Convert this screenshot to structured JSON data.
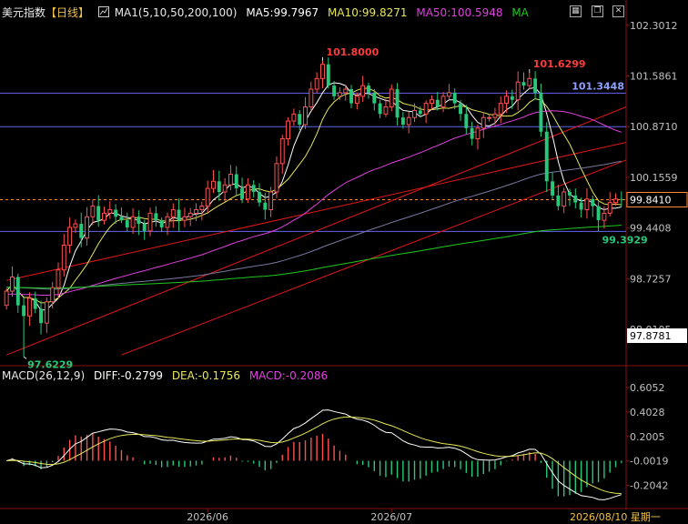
{
  "header": {
    "symbol": "美元指数",
    "period": "【日线】",
    "ma_group": "MA1(5,10,50,200,100)",
    "ma5": "MA5:99.7967",
    "ma10": "MA10:99.8271",
    "ma50": "MA50:100.5948",
    "ma_more": "MA",
    "icon": "indicator-icon",
    "window_buttons": [
      "grid-icon",
      "restore-icon",
      "close-icon"
    ]
  },
  "macd_header": {
    "name": "MACD(26,12,9)",
    "diff": "DIFF:-0.2799",
    "dea": "DEA:-0.1756",
    "macd": "MACD:-0.2086"
  },
  "colors": {
    "up": "#ff5050",
    "down": "#28c87a",
    "ma5": "#ffffff",
    "ma10": "#e6e65a",
    "ma50": "#e040e0",
    "ma100": "#7878a0",
    "ma200": "#1ec81e",
    "trend": "#e01818",
    "hline": "#6464f0",
    "current": "#ff8c32"
  },
  "chart_data": [
    {
      "type": "candlestick",
      "title": "美元指数 日线",
      "ylim": [
        97.55,
        102.35
      ],
      "y_ticks": [
        102.3012,
        101.5861,
        100.871,
        100.1559,
        99.4408,
        98.7257,
        98.0105
      ],
      "y_tick_labels": [
        "102.3012",
        "101.5861",
        "100.8710",
        "100.1559",
        "99.4408",
        "98.7257",
        "98.0105"
      ],
      "current_price": 99.841,
      "current_label": "99.8410",
      "cursor_price_label": "97.8781",
      "annotations": [
        {
          "label": "101.8000",
          "value": 101.8,
          "candle": 55
        },
        {
          "label": "101.6299",
          "value": 101.6299,
          "candle": 91
        },
        {
          "label": "101.3448",
          "value": 101.3448,
          "candle": 105
        },
        {
          "label": "99.3929",
          "value": 99.3929,
          "candle": 103
        },
        {
          "label": "97.6229",
          "value": 97.6229,
          "candle": 3
        }
      ],
      "horizontal_lines": [
        101.3448,
        100.871,
        99.3929
      ],
      "trend_lines": [
        {
          "from": [
            0,
            97.65
          ],
          "to": [
            115,
            101.15
          ]
        },
        {
          "from": [
            20,
            97.65
          ],
          "to": [
            115,
            100.4
          ]
        },
        {
          "from": [
            0,
            98.7
          ],
          "to": [
            115,
            100.65
          ]
        }
      ],
      "x_labels": [
        {
          "label": "2026/06",
          "candle": 35
        },
        {
          "label": "2026/07",
          "candle": 67
        },
        {
          "label": "2026/08/10 星期一",
          "candle": 98
        }
      ],
      "closes": [
        98.55,
        98.75,
        98.35,
        98.2,
        98.45,
        98.3,
        98.1,
        98.4,
        98.6,
        98.85,
        99.2,
        99.45,
        99.5,
        99.3,
        99.6,
        99.75,
        99.55,
        99.65,
        99.7,
        99.6,
        99.55,
        99.45,
        99.6,
        99.5,
        99.4,
        99.65,
        99.55,
        99.45,
        99.6,
        99.7,
        99.55,
        99.6,
        99.65,
        99.7,
        99.75,
        100.0,
        100.1,
        99.95,
        100.05,
        100.2,
        100.0,
        99.85,
        100.05,
        99.95,
        99.8,
        99.7,
        99.95,
        100.35,
        100.7,
        100.95,
        101.05,
        100.9,
        101.15,
        101.4,
        101.55,
        101.75,
        101.45,
        101.3,
        101.35,
        101.4,
        101.2,
        101.3,
        101.45,
        101.35,
        101.2,
        101.05,
        101.15,
        101.4,
        101.0,
        100.9,
        101.0,
        101.1,
        101.05,
        101.2,
        101.25,
        101.15,
        101.3,
        101.35,
        101.2,
        101.05,
        100.85,
        100.7,
        100.85,
        101.0,
        101.0,
        101.05,
        101.2,
        101.3,
        101.25,
        101.5,
        101.45,
        101.55,
        101.35,
        100.8,
        100.1,
        99.9,
        99.75,
        99.95,
        99.9,
        99.8,
        99.7,
        99.85,
        99.75,
        99.55,
        99.65,
        99.8,
        99.85,
        99.84
      ]
    },
    {
      "type": "bar+line",
      "title": "MACD(26,12,9)",
      "ylim": [
        -0.38,
        0.68
      ],
      "y_ticks": [
        0.6052,
        0.4028,
        0.2005,
        -0.0019,
        -0.2042
      ],
      "y_tick_labels": [
        "0.6052",
        "0.4028",
        "0.2005",
        "-0.0019",
        "-0.2042"
      ],
      "series": [
        {
          "name": "DIFF",
          "color": "#ffffff",
          "key": "diff",
          "last": -0.2799
        },
        {
          "name": "DEA",
          "color": "#e6e65a",
          "key": "dea",
          "last": -0.1756
        },
        {
          "name": "MACD",
          "color": "#e040e0",
          "key": "macd",
          "last": -0.2086
        }
      ]
    }
  ]
}
